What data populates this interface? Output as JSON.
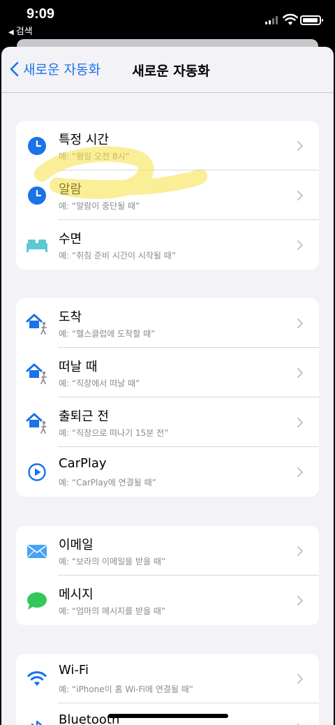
{
  "status_bar": {
    "time": "9:09",
    "back_app": "검색"
  },
  "nav": {
    "back_label": "새로운 자동화",
    "title": "새로운 자동화"
  },
  "colors": {
    "accent": "#1a73e8",
    "highlight": "#f5e042",
    "message_green": "#34c759",
    "bed_teal": "#5ac8d0"
  },
  "groups": [
    {
      "rows": [
        {
          "icon": "clock-icon",
          "title": "특정 시간",
          "subtitle": "예: “평일 오전 8시”"
        },
        {
          "icon": "alarm-clock-icon",
          "title": "알람",
          "subtitle": "예: “알람이 중단될 때”"
        },
        {
          "icon": "bed-icon",
          "title": "수면",
          "subtitle": "예: “취침 준비 시간이 시작될 때”"
        }
      ]
    },
    {
      "rows": [
        {
          "icon": "home-person-icon",
          "title": "도착",
          "subtitle": "예: “헬스클럽에 도착할 때”"
        },
        {
          "icon": "home-person-icon",
          "title": "떠날 때",
          "subtitle": "예: “직장에서 떠날 때”"
        },
        {
          "icon": "home-person-icon",
          "title": "출퇴근 전",
          "subtitle": "예: “직장으로 떠나기 15분 전”"
        },
        {
          "icon": "carplay-icon",
          "title": "CarPlay",
          "subtitle": "예: “CarPlay에 연결될 때”"
        }
      ]
    },
    {
      "rows": [
        {
          "icon": "mail-icon",
          "title": "이메일",
          "subtitle": "예: “보라의 이메일을 받을 때”"
        },
        {
          "icon": "message-icon",
          "title": "메시지",
          "subtitle": "예: “엄마의 메시지를 받을 때”"
        }
      ]
    },
    {
      "rows": [
        {
          "icon": "wifi-icon",
          "title": "Wi-Fi",
          "subtitle": "예: “iPhone이 홈 Wi-Fi에 연결될 때”"
        },
        {
          "icon": "bluetooth-icon",
          "title": "Bluetooth",
          "subtitle": ""
        }
      ]
    }
  ]
}
